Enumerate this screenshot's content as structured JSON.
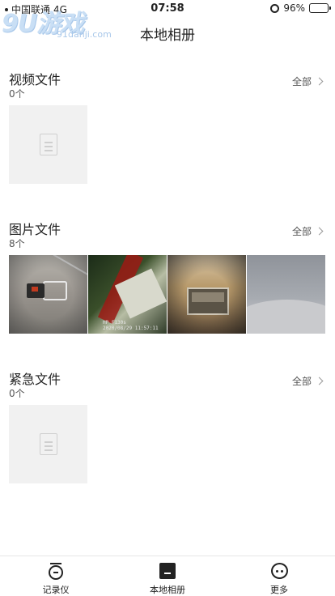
{
  "status_bar": {
    "carrier": "中国联通",
    "network": "4G",
    "time": "07:58",
    "battery": "96%",
    "battery_color": "#f5d21a"
  },
  "watermark": {
    "brand": "9U游戏",
    "site": "91danji.com"
  },
  "header": {
    "title": "本地相册"
  },
  "sections": [
    {
      "title": "视频文件",
      "count": "0个",
      "more": "全部"
    },
    {
      "title": "图片文件",
      "count": "8个",
      "more": "全部"
    },
    {
      "title": "紧急文件",
      "count": "0个",
      "more": "全部"
    }
  ],
  "thumbnails": {
    "t2_stamp_line1": "HP F130s",
    "t2_stamp_line2": "2020/08/29 11:57:11"
  },
  "tabs": [
    {
      "label": "记录仪",
      "icon": "recorder-icon"
    },
    {
      "label": "本地相册",
      "icon": "album-icon"
    },
    {
      "label": "更多",
      "icon": "more-icon"
    }
  ]
}
